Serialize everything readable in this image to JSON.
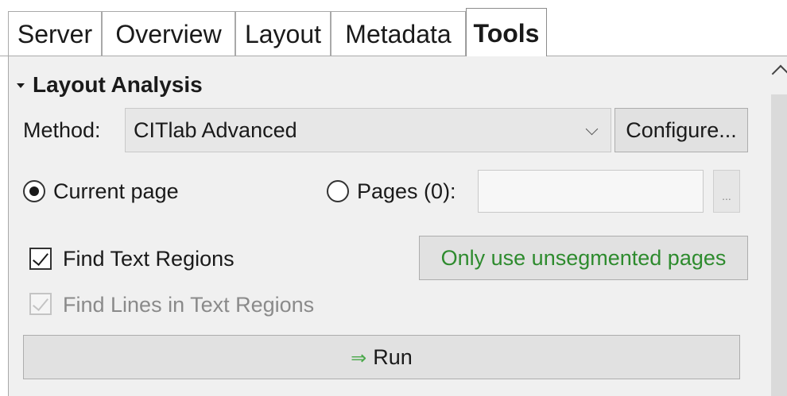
{
  "tabs": [
    {
      "label": "Server",
      "active": false
    },
    {
      "label": "Overview",
      "active": false
    },
    {
      "label": "Layout",
      "active": false
    },
    {
      "label": "Metadata",
      "active": false
    },
    {
      "label": "Tools",
      "active": true
    }
  ],
  "layout_analysis": {
    "section_title": "Layout Analysis",
    "method_label": "Method:",
    "method_value": "CITlab Advanced",
    "configure_label": "Configure...",
    "current_page_label": "Current page",
    "current_page_selected": true,
    "pages_label": "Pages (0):",
    "pages_selected": false,
    "pages_value": "",
    "pages_browse_label": "...",
    "find_text_regions_label": "Find Text Regions",
    "find_text_regions_checked": true,
    "only_unsegmented_label": "Only use unsegmented pages",
    "find_lines_label": "Find Lines in Text Regions",
    "find_lines_checked": true,
    "find_lines_enabled": false,
    "run_label": "Run",
    "run_icon": "double-arrow-right-icon"
  },
  "colors": {
    "panel_bg": "#f0f0f0",
    "accent_green": "#2e8b2e",
    "run_arrow_green": "#4aa84a"
  }
}
